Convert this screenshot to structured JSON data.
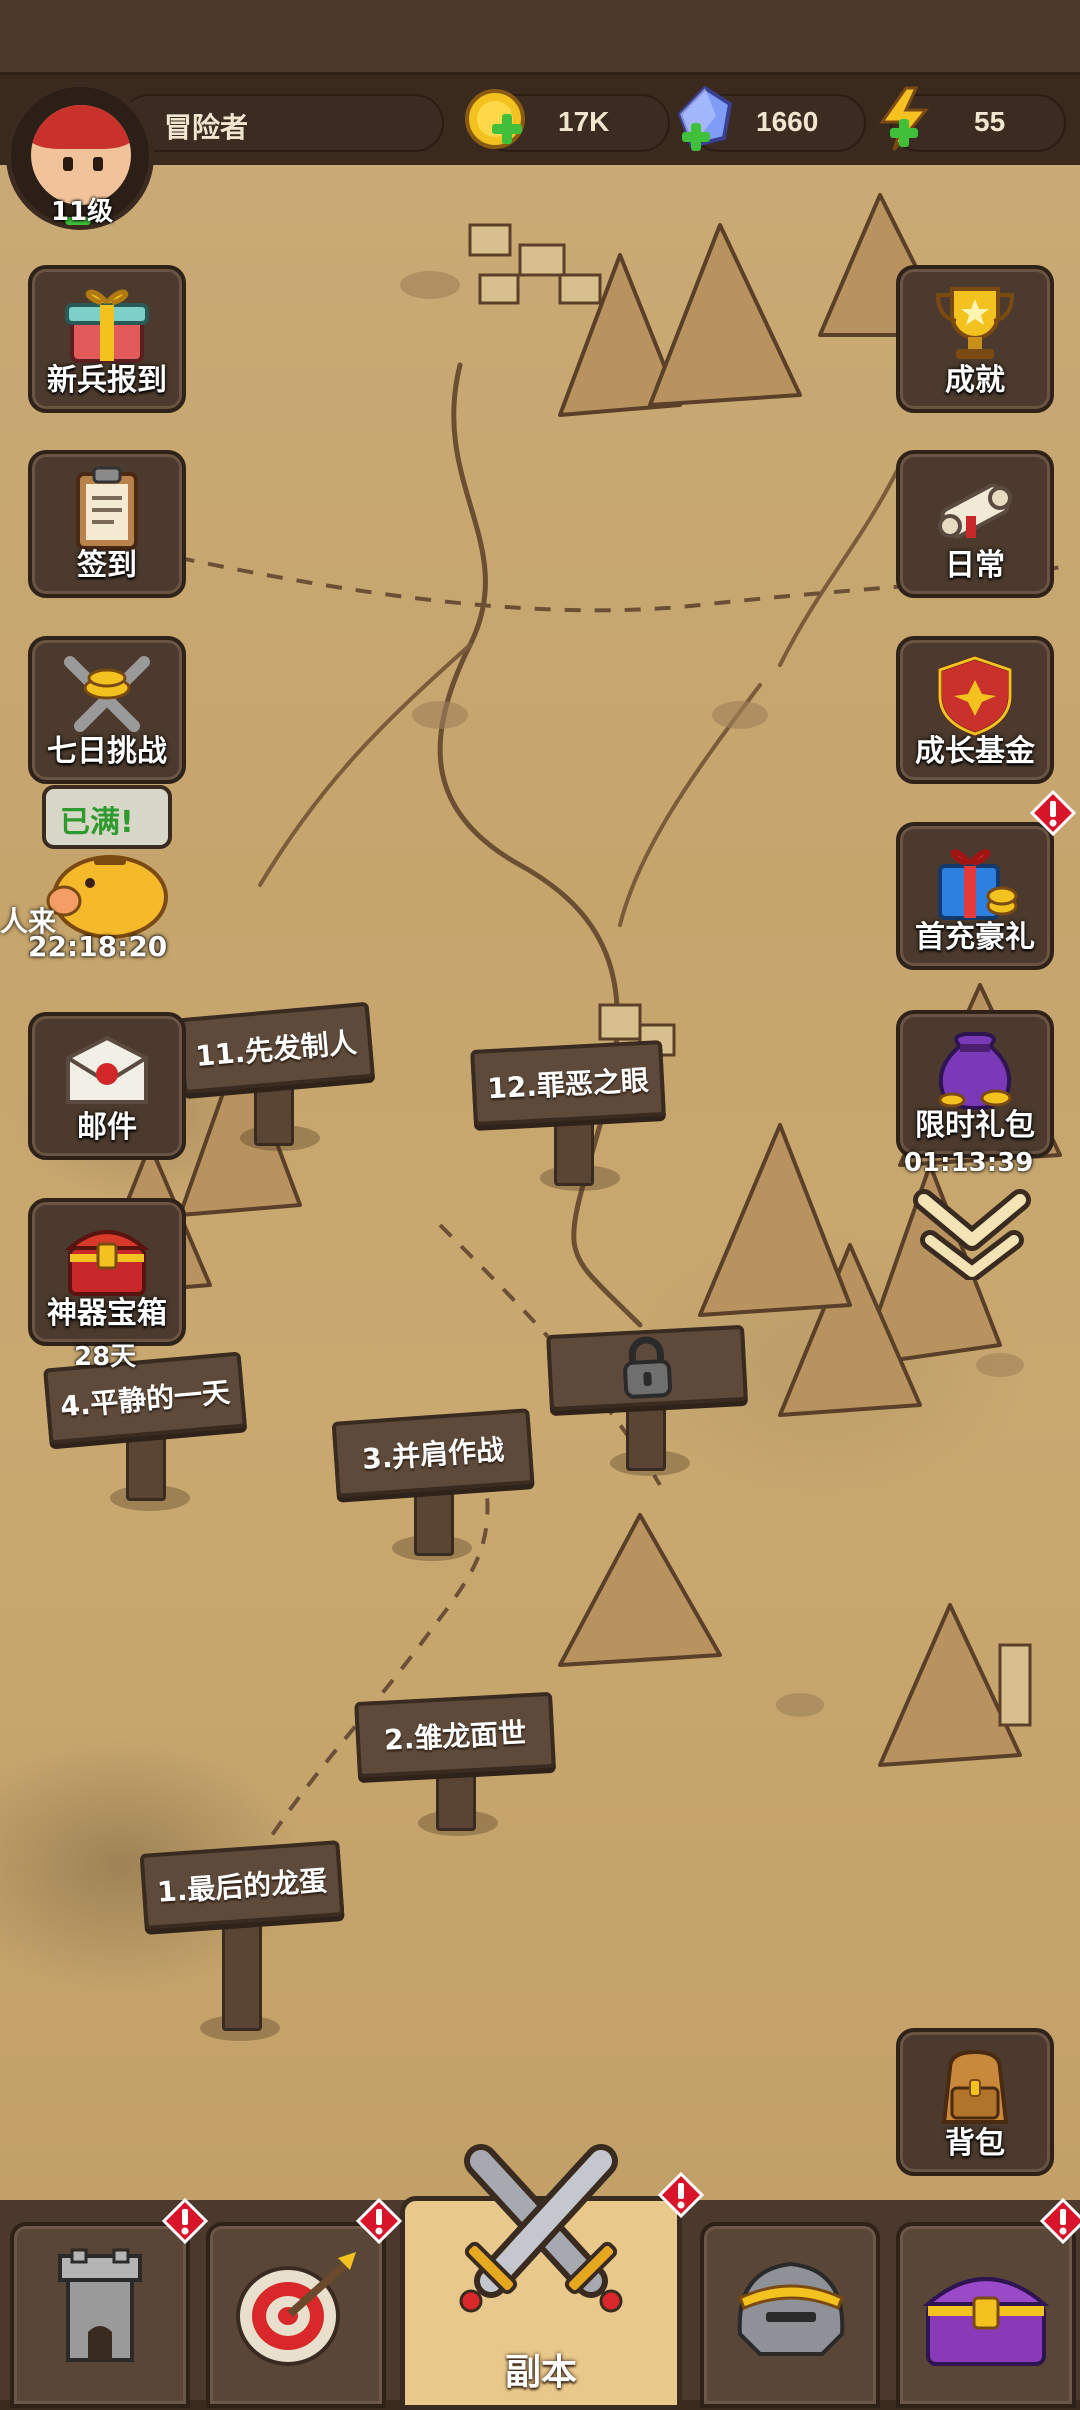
{
  "player": {
    "name": "冒险者",
    "level": "11级"
  },
  "currency": {
    "gold": "17K",
    "gems": "1660",
    "energy": "55"
  },
  "left_menu": [
    {
      "label": "新兵报到",
      "icon": "gift-box-icon"
    },
    {
      "label": "签到",
      "icon": "clipboard-icon"
    },
    {
      "label": "七日挑战",
      "icon": "crossed-swords-icon"
    },
    {
      "label": "邮件",
      "icon": "envelope-icon"
    },
    {
      "label": "神器宝箱",
      "icon": "treasure-chest-icon",
      "sub": "28天"
    }
  ],
  "piggy": {
    "bubble": "已满!",
    "timer": "22:18:20",
    "partial_label": "人来"
  },
  "right_menu": [
    {
      "label": "成就",
      "icon": "trophy-icon"
    },
    {
      "label": "日常",
      "icon": "scroll-icon"
    },
    {
      "label": "成长基金",
      "icon": "shield-fund-icon"
    },
    {
      "label": "首充豪礼",
      "icon": "first-charge-gift-icon"
    },
    {
      "label": "限时礼包",
      "icon": "money-bag-icon",
      "sub": "01:13:39"
    },
    {
      "label": "背包",
      "icon": "backpack-icon"
    }
  ],
  "stages": [
    {
      "label": "1.最后的龙蛋"
    },
    {
      "label": "2.雏龙面世"
    },
    {
      "label": "3.并肩作战"
    },
    {
      "label": "4.平静的一天"
    },
    {
      "label": "11.先发制人"
    },
    {
      "label": "12.罪恶之眼"
    }
  ],
  "bottom_nav": [
    {
      "label": "",
      "icon": "tower-icon",
      "alert": "!"
    },
    {
      "label": "",
      "icon": "target-icon",
      "alert": "!"
    },
    {
      "label": "副本",
      "icon": "crossed-swords-icon",
      "alert": "!"
    },
    {
      "label": "",
      "icon": "helmet-icon"
    },
    {
      "label": "",
      "icon": "chest-icon",
      "alert": "!"
    }
  ],
  "colors": {
    "accent": "#e9c98b",
    "map": "#c9aa74",
    "panel": "#4b3a2d",
    "alert": "#d8142a"
  }
}
